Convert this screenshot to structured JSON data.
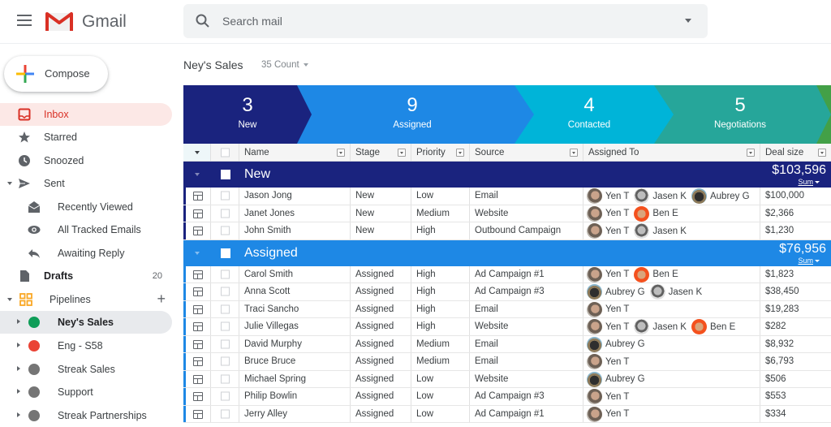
{
  "app": {
    "title": "Gmail"
  },
  "search": {
    "placeholder": "Search mail"
  },
  "compose": {
    "label": "Compose"
  },
  "nav": {
    "inbox": "Inbox",
    "starred": "Starred",
    "snoozed": "Snoozed",
    "sent": "Sent",
    "recently_viewed": "Recently Viewed",
    "all_tracked": "All Tracked Emails",
    "awaiting_reply": "Awaiting Reply",
    "drafts": "Drafts",
    "drafts_count": "20",
    "pipelines": "Pipelines",
    "pipeline_items": [
      {
        "label": "Ney's Sales",
        "color": "#0f9d58"
      },
      {
        "label": "Eng - S58",
        "color": "#ea4335"
      },
      {
        "label": "Streak Sales",
        "color": "#757575"
      },
      {
        "label": "Support",
        "color": "#757575"
      },
      {
        "label": "Streak Partnerships",
        "color": "#757575"
      }
    ]
  },
  "pipeline": {
    "title": "Ney's Sales",
    "count": "35 Count"
  },
  "stages": [
    {
      "count": "3",
      "name": "New",
      "color": "#1a237e"
    },
    {
      "count": "9",
      "name": "Assigned",
      "color": "#1e88e5"
    },
    {
      "count": "4",
      "name": "Contacted",
      "color": "#00b4d8"
    },
    {
      "count": "5",
      "name": "Negotiations",
      "color": "#26a69a"
    },
    {
      "count": "",
      "name": "",
      "color": "#43a047"
    }
  ],
  "columns": [
    "Name",
    "Stage",
    "Priority",
    "Source",
    "Assigned To",
    "Deal size"
  ],
  "groups": [
    {
      "name": "New",
      "sum": "$103,596",
      "sum_label": "Sum",
      "color": "#1a237e",
      "rows": [
        {
          "name": "Jason Jong",
          "stage": "New",
          "priority": "Low",
          "source": "Email",
          "assigned": [
            "Yen T",
            "Jasen K",
            "Aubrey G"
          ],
          "deal": "$100,000"
        },
        {
          "name": "Janet Jones",
          "stage": "New",
          "priority": "Medium",
          "source": "Website",
          "assigned": [
            "Yen T",
            "Ben E"
          ],
          "deal": "$2,366"
        },
        {
          "name": "John Smith",
          "stage": "New",
          "priority": "High",
          "source": "Outbound Campaign",
          "assigned": [
            "Yen T",
            "Jasen K"
          ],
          "deal": "$1,230"
        }
      ]
    },
    {
      "name": "Assigned",
      "sum": "$76,956",
      "sum_label": "Sum",
      "color": "#1e88e5",
      "rows": [
        {
          "name": "Carol Smith",
          "stage": "Assigned",
          "priority": "High",
          "source": "Ad Campaign #1",
          "assigned": [
            "Yen T",
            "Ben E"
          ],
          "deal": "$1,823"
        },
        {
          "name": "Anna Scott",
          "stage": "Assigned",
          "priority": "High",
          "source": "Ad Campaign #3",
          "assigned": [
            "Aubrey G",
            "Jasen K"
          ],
          "deal": "$38,450"
        },
        {
          "name": "Traci Sancho",
          "stage": "Assigned",
          "priority": "High",
          "source": "Email",
          "assigned": [
            "Yen T"
          ],
          "deal": "$19,283"
        },
        {
          "name": "Julie Villegas",
          "stage": "Assigned",
          "priority": "High",
          "source": "Website",
          "assigned": [
            "Yen T",
            "Jasen K",
            "Ben E"
          ],
          "deal": "$282"
        },
        {
          "name": "David Murphy",
          "stage": "Assigned",
          "priority": "Medium",
          "source": "Email",
          "assigned": [
            "Aubrey G"
          ],
          "deal": "$8,932"
        },
        {
          "name": "Bruce Bruce",
          "stage": "Assigned",
          "priority": "Medium",
          "source": "Email",
          "assigned": [
            "Yen T"
          ],
          "deal": "$6,793"
        },
        {
          "name": "Michael Spring",
          "stage": "Assigned",
          "priority": "Low",
          "source": "Website",
          "assigned": [
            "Aubrey G"
          ],
          "deal": "$506"
        },
        {
          "name": "Philip Bowlin",
          "stage": "Assigned",
          "priority": "Low",
          "source": "Ad Campaign #3",
          "assigned": [
            "Yen T"
          ],
          "deal": "$553"
        },
        {
          "name": "Jerry Alley",
          "stage": "Assigned",
          "priority": "Low",
          "source": "Ad Campaign #1",
          "assigned": [
            "Yen T"
          ],
          "deal": "$334"
        }
      ]
    }
  ]
}
